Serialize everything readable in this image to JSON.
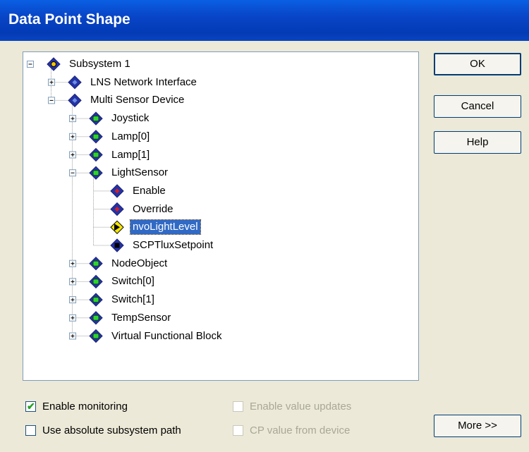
{
  "window": {
    "title": "Data Point Shape"
  },
  "tree": {
    "nodes": [
      {
        "label": "Subsystem 1",
        "level": 0,
        "kind": "subsystem",
        "expander": "minus",
        "selected": false
      },
      {
        "label": "LNS Network Interface",
        "level": 1,
        "kind": "device",
        "expander": "plus",
        "selected": false
      },
      {
        "label": "Multi Sensor Device",
        "level": 1,
        "kind": "device",
        "expander": "minus",
        "selected": false
      },
      {
        "label": "Joystick",
        "level": 2,
        "kind": "block",
        "expander": "plus",
        "selected": false
      },
      {
        "label": "Lamp[0]",
        "level": 2,
        "kind": "block",
        "expander": "plus",
        "selected": false
      },
      {
        "label": "Lamp[1]",
        "level": 2,
        "kind": "block",
        "expander": "plus",
        "selected": false
      },
      {
        "label": "LightSensor",
        "level": 2,
        "kind": "block",
        "expander": "minus",
        "selected": false
      },
      {
        "label": "Enable",
        "level": 3,
        "kind": "input",
        "expander": "none",
        "selected": false
      },
      {
        "label": "Override",
        "level": 3,
        "kind": "input",
        "expander": "none",
        "selected": false
      },
      {
        "label": "nvoLightLevel",
        "level": 3,
        "kind": "output",
        "expander": "none",
        "selected": true
      },
      {
        "label": "SCPTluxSetpoint",
        "level": 3,
        "kind": "property",
        "expander": "none",
        "selected": false
      },
      {
        "label": "NodeObject",
        "level": 2,
        "kind": "block",
        "expander": "plus",
        "selected": false
      },
      {
        "label": "Switch[0]",
        "level": 2,
        "kind": "block",
        "expander": "plus",
        "selected": false
      },
      {
        "label": "Switch[1]",
        "level": 2,
        "kind": "block",
        "expander": "plus",
        "selected": false
      },
      {
        "label": "TempSensor",
        "level": 2,
        "kind": "block",
        "expander": "plus",
        "selected": false
      },
      {
        "label": "Virtual Functional Block",
        "level": 2,
        "kind": "block",
        "expander": "plus",
        "selected": false
      }
    ]
  },
  "buttons": {
    "ok": "OK",
    "cancel": "Cancel",
    "help": "Help",
    "more": "More >>"
  },
  "options": {
    "enable_monitoring": {
      "label": "Enable monitoring",
      "checked": true,
      "enabled": true
    },
    "use_absolute_path": {
      "label": "Use absolute subsystem path",
      "checked": false,
      "enabled": true
    },
    "enable_value_updates": {
      "label": "Enable value updates",
      "checked": false,
      "enabled": false
    },
    "cp_value_from_device": {
      "label": "CP value from device",
      "checked": false,
      "enabled": false
    }
  },
  "colors": {
    "title_bar": "#0A46C8",
    "dialog_bg": "#ECE9D8",
    "selection": "#316AC5",
    "node_green": "#2FD42F",
    "node_blue": "#2433A8"
  },
  "icons": {
    "subsystem": "diamond-subsystem-icon",
    "device": "diamond-device-icon",
    "block": "diamond-block-icon",
    "input": "diamond-input-icon",
    "output": "arrow-output-icon",
    "property": "diamond-property-icon"
  }
}
